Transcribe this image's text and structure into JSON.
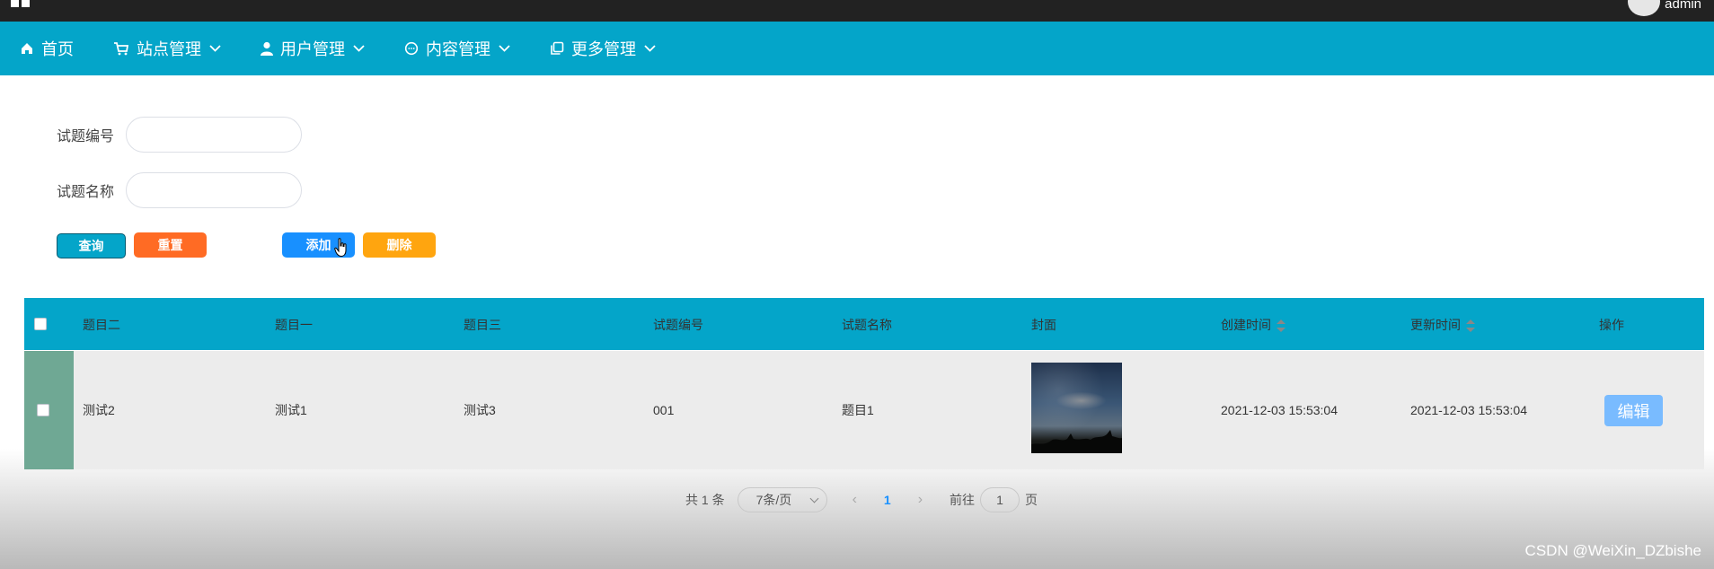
{
  "topbar": {
    "username": "admin"
  },
  "nav": [
    {
      "label": "首页",
      "icon": "home-icon",
      "has_dropdown": false
    },
    {
      "label": "站点管理",
      "icon": "cart-icon",
      "has_dropdown": true
    },
    {
      "label": "用户管理",
      "icon": "user-icon",
      "has_dropdown": true
    },
    {
      "label": "内容管理",
      "icon": "chat-icon",
      "has_dropdown": true
    },
    {
      "label": "更多管理",
      "icon": "copy-icon",
      "has_dropdown": true
    }
  ],
  "form": {
    "field1_label": "试题编号",
    "field1_value": "",
    "field2_label": "试题名称",
    "field2_value": ""
  },
  "buttons": {
    "search": "查询",
    "reset": "重置",
    "add": "添加",
    "delete": "删除"
  },
  "colors": {
    "nav_bg": "#04a5c9",
    "search_btn": "#04a5c9",
    "reset_btn": "#ff6b24",
    "add_btn": "#1890ff",
    "delete_btn": "#ffa50f",
    "edit_btn": "#79bbff",
    "row_selection": "#6fa894"
  },
  "table": {
    "headers": [
      "题目二",
      "题目一",
      "题目三",
      "试题编号",
      "试题名称",
      "封面",
      "创建时间",
      "更新时间",
      "操作"
    ],
    "rows": [
      {
        "c1": "测试2",
        "c2": "测试1",
        "c3": "测试3",
        "c4": "001",
        "c5": "题目1",
        "cover": "night-sky-image",
        "created": "2021-12-03 15:53:04",
        "updated": "2021-12-03 15:53:04",
        "action": "编辑"
      }
    ]
  },
  "pagination": {
    "total": "共 1 条",
    "page_size": "7条/页",
    "prev": "‹",
    "current": "1",
    "next": "›",
    "goto_prefix": "前往",
    "goto_value": "1",
    "goto_suffix": "页"
  },
  "watermark": "CSDN @WeiXin_DZbishe"
}
